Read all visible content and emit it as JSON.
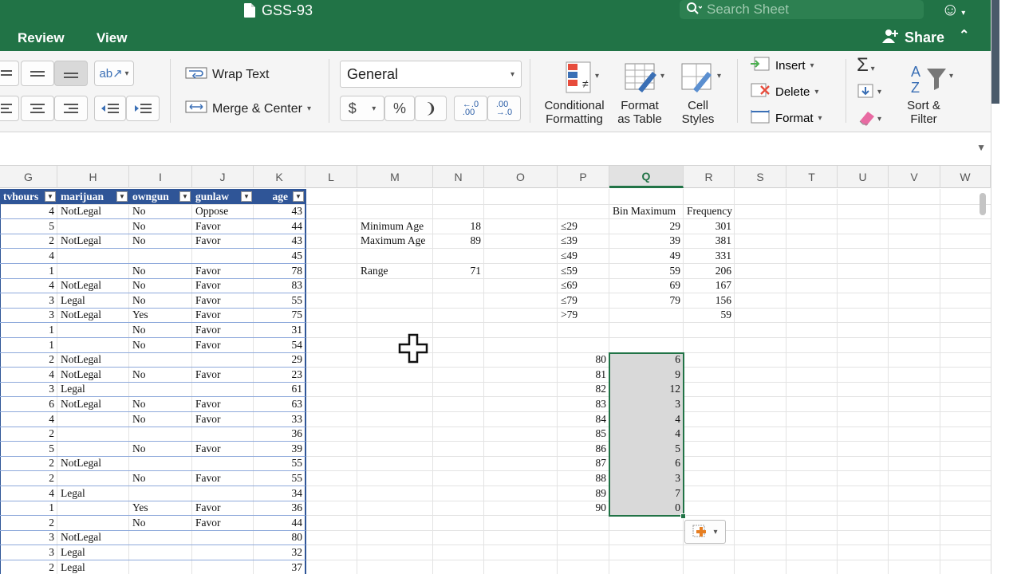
{
  "window": {
    "title": "GSS-93"
  },
  "search": {
    "placeholder": "Search Sheet"
  },
  "ribbon_tabs": [
    "Review",
    "View"
  ],
  "share": {
    "label": "Share"
  },
  "ribbon": {
    "wrap_text": "Wrap Text",
    "merge_center": "Merge & Center",
    "number_format": "General",
    "currency": "$",
    "percent": "%",
    "comma": "❩",
    "increase_decimal": "←.0\n.00",
    "decrease_decimal": ".00\n→.0",
    "conditional_formatting": [
      "Conditional",
      "Formatting"
    ],
    "format_as_table": [
      "Format",
      "as Table"
    ],
    "cell_styles": [
      "Cell",
      "Styles"
    ],
    "insert": "Insert",
    "delete": "Delete",
    "format": "Format",
    "sort_filter": [
      "Sort &",
      "Filter"
    ]
  },
  "columns": [
    "G",
    "H",
    "I",
    "J",
    "K",
    "L",
    "M",
    "N",
    "O",
    "P",
    "Q",
    "R",
    "S",
    "T",
    "U",
    "V",
    "W"
  ],
  "active_column": "Q",
  "table": {
    "headers": [
      "tvhours",
      "marijuan",
      "owngun",
      "gunlaw",
      "age"
    ],
    "rows": [
      [
        "4",
        "NotLegal",
        "No",
        "Oppose",
        "43"
      ],
      [
        "5",
        "",
        "No",
        "Favor",
        "44"
      ],
      [
        "2",
        "NotLegal",
        "No",
        "Favor",
        "43"
      ],
      [
        "4",
        "",
        "",
        "",
        "45"
      ],
      [
        "1",
        "",
        "No",
        "Favor",
        "78"
      ],
      [
        "4",
        "NotLegal",
        "No",
        "Favor",
        "83"
      ],
      [
        "3",
        "Legal",
        "No",
        "Favor",
        "55"
      ],
      [
        "3",
        "NotLegal",
        "Yes",
        "Favor",
        "75"
      ],
      [
        "1",
        "",
        "No",
        "Favor",
        "31"
      ],
      [
        "1",
        "",
        "No",
        "Favor",
        "54"
      ],
      [
        "2",
        "NotLegal",
        "",
        "",
        "29"
      ],
      [
        "4",
        "NotLegal",
        "No",
        "Favor",
        "23"
      ],
      [
        "3",
        "Legal",
        "",
        "",
        "61"
      ],
      [
        "6",
        "NotLegal",
        "No",
        "Favor",
        "63"
      ],
      [
        "4",
        "",
        "No",
        "Favor",
        "33"
      ],
      [
        "2",
        "",
        "",
        "",
        "36"
      ],
      [
        "5",
        "",
        "No",
        "Favor",
        "39"
      ],
      [
        "2",
        "NotLegal",
        "",
        "",
        "55"
      ],
      [
        "2",
        "",
        "No",
        "Favor",
        "55"
      ],
      [
        "4",
        "Legal",
        "",
        "",
        "34"
      ],
      [
        "1",
        "",
        "Yes",
        "Favor",
        "36"
      ],
      [
        "2",
        "",
        "No",
        "Favor",
        "44"
      ],
      [
        "3",
        "NotLegal",
        "",
        "",
        "80"
      ],
      [
        "3",
        "Legal",
        "",
        "",
        "32"
      ],
      [
        "2",
        "Legal",
        "",
        "",
        "37"
      ]
    ]
  },
  "stats": [
    {
      "label": "Minimum Age",
      "value": "18",
      "row": 1
    },
    {
      "label": "Maximum Age",
      "value": "89",
      "row": 2
    },
    {
      "label": "Range",
      "value": "71",
      "row": 4
    }
  ],
  "frequency_table": {
    "header_bin": "Bin Maximum",
    "header_freq": "Frequency",
    "rows": [
      {
        "label": "≤29",
        "bin": "29",
        "freq": "301"
      },
      {
        "label": "≤39",
        "bin": "39",
        "freq": "381"
      },
      {
        "label": "≤49",
        "bin": "49",
        "freq": "331"
      },
      {
        "label": "≤59",
        "bin": "59",
        "freq": "206"
      },
      {
        "label": "≤69",
        "bin": "69",
        "freq": "167"
      },
      {
        "label": "≤79",
        "bin": "79",
        "freq": "156"
      },
      {
        "label": ">79",
        "bin": "",
        "freq": "59"
      }
    ]
  },
  "age_counts": [
    {
      "age": "80",
      "count": "6"
    },
    {
      "age": "81",
      "count": "9"
    },
    {
      "age": "82",
      "count": "12"
    },
    {
      "age": "83",
      "count": "3"
    },
    {
      "age": "84",
      "count": "4"
    },
    {
      "age": "85",
      "count": "4"
    },
    {
      "age": "86",
      "count": "5"
    },
    {
      "age": "87",
      "count": "6"
    },
    {
      "age": "88",
      "count": "3"
    },
    {
      "age": "89",
      "count": "7"
    },
    {
      "age": "90",
      "count": "0"
    }
  ],
  "colors": {
    "accent": "#217346",
    "table_header": "#2f5597",
    "selection": "#d9d9d9"
  }
}
